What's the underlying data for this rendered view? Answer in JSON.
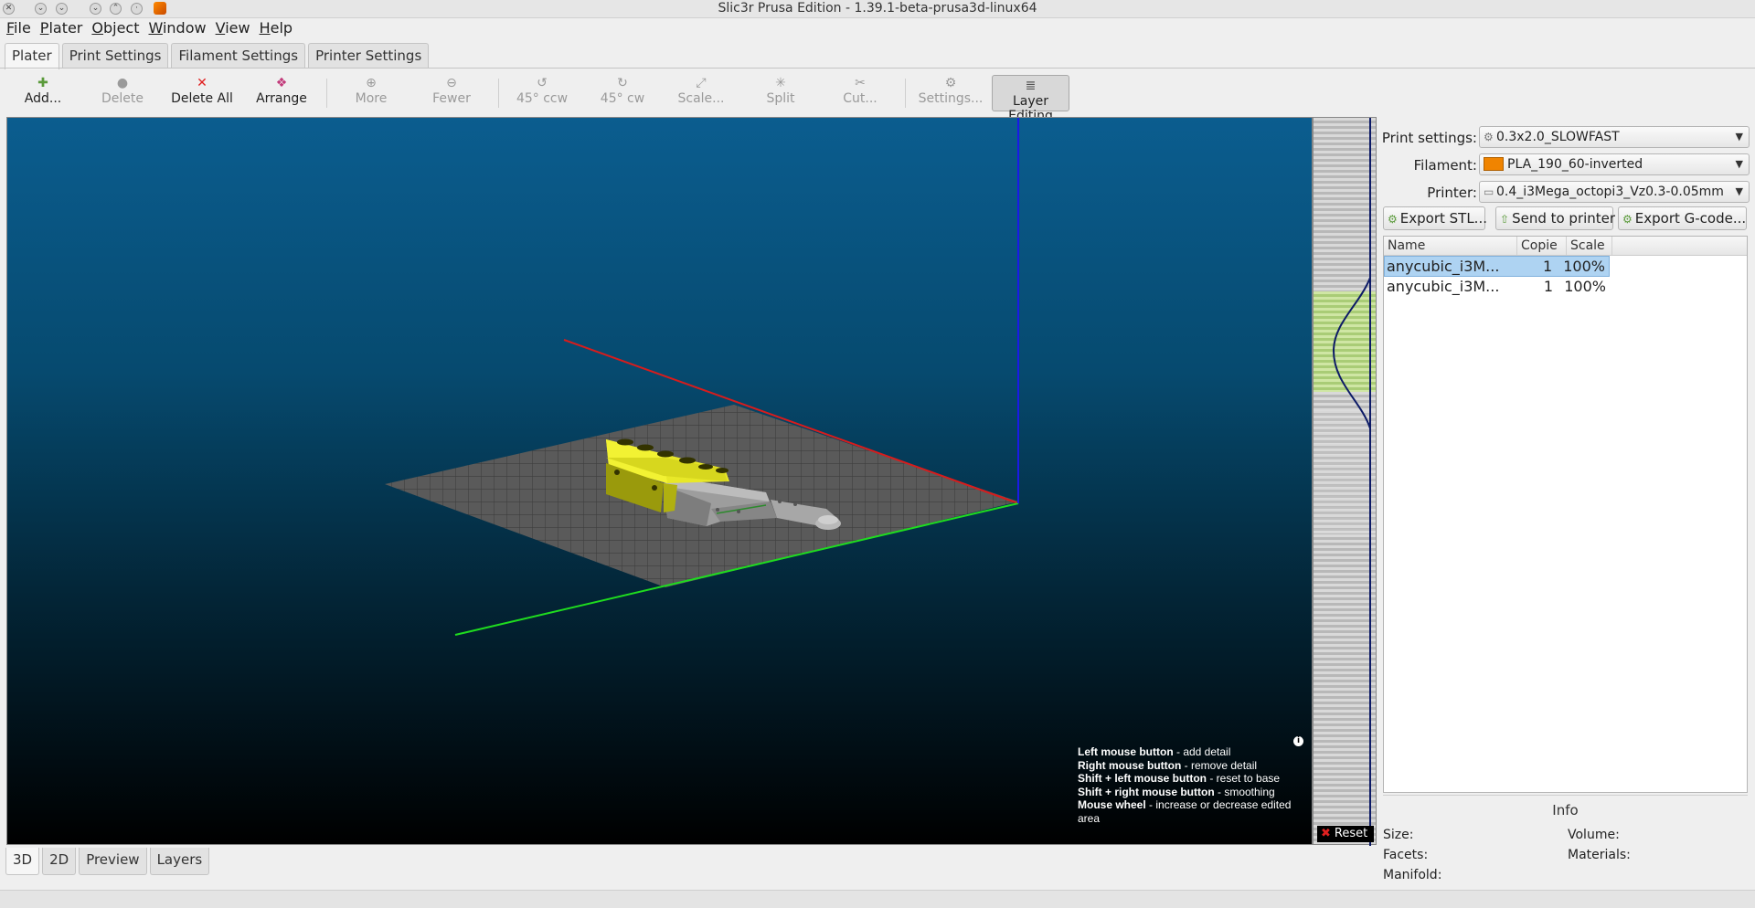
{
  "window": {
    "title": "Slic3r Prusa Edition - 1.39.1-beta-prusa3d-linux64"
  },
  "menu": [
    {
      "u": "F",
      "rest": "ile"
    },
    {
      "u": "P",
      "rest": "later"
    },
    {
      "u": "O",
      "rest": "bject"
    },
    {
      "u": "W",
      "rest": "indow"
    },
    {
      "u": "V",
      "rest": "iew"
    },
    {
      "u": "H",
      "rest": "elp"
    }
  ],
  "tabs": [
    "Plater",
    "Print Settings",
    "Filament Settings",
    "Printer Settings"
  ],
  "toolbar": {
    "add": "Add...",
    "delete": "Delete",
    "delete_all": "Delete All",
    "arrange": "Arrange",
    "more": "More",
    "fewer": "Fewer",
    "rot_ccw": "45° ccw",
    "rot_cw": "45° cw",
    "scale": "Scale...",
    "split": "Split",
    "cut": "Cut...",
    "settings": "Settings...",
    "layer_editing": "Layer Editing"
  },
  "help": [
    {
      "key": "Left mouse button",
      "desc": " - add detail"
    },
    {
      "key": "Right mouse button",
      "desc": " - remove detail"
    },
    {
      "key": "Shift + left mouse button",
      "desc": " - reset to base"
    },
    {
      "key": "Shift + right mouse button",
      "desc": " - smoothing"
    },
    {
      "key": "Mouse wheel",
      "desc": " - increase or decrease edited area"
    }
  ],
  "reset_label": "Reset",
  "bottom_tabs": [
    "3D",
    "2D",
    "Preview",
    "Layers"
  ],
  "settings": {
    "print_label": "Print settings:",
    "print_value": "0.3x2.0_SLOWFAST",
    "filament_label": "Filament:",
    "filament_value": "PLA_190_60-inverted",
    "filament_color": "#f08400",
    "printer_label": "Printer:",
    "printer_value": "0.4_i3Mega_octopi3_Vz0.3-0.05mm"
  },
  "actions": {
    "export_stl": "Export STL...",
    "send_to_printer": "Send to printer",
    "export_gcode": "Export G-code..."
  },
  "objects": {
    "headers": [
      "Name",
      "Copie",
      "Scale"
    ],
    "rows": [
      {
        "name": "anycubic_i3M...",
        "copies": "1",
        "scale": "100%",
        "selected": true
      },
      {
        "name": "anycubic_i3M...",
        "copies": "1",
        "scale": "100%",
        "selected": false
      }
    ]
  },
  "info": {
    "title": "Info",
    "size": "Size:",
    "volume": "Volume:",
    "facets": "Facets:",
    "materials": "Materials:",
    "manifold": "Manifold:"
  }
}
